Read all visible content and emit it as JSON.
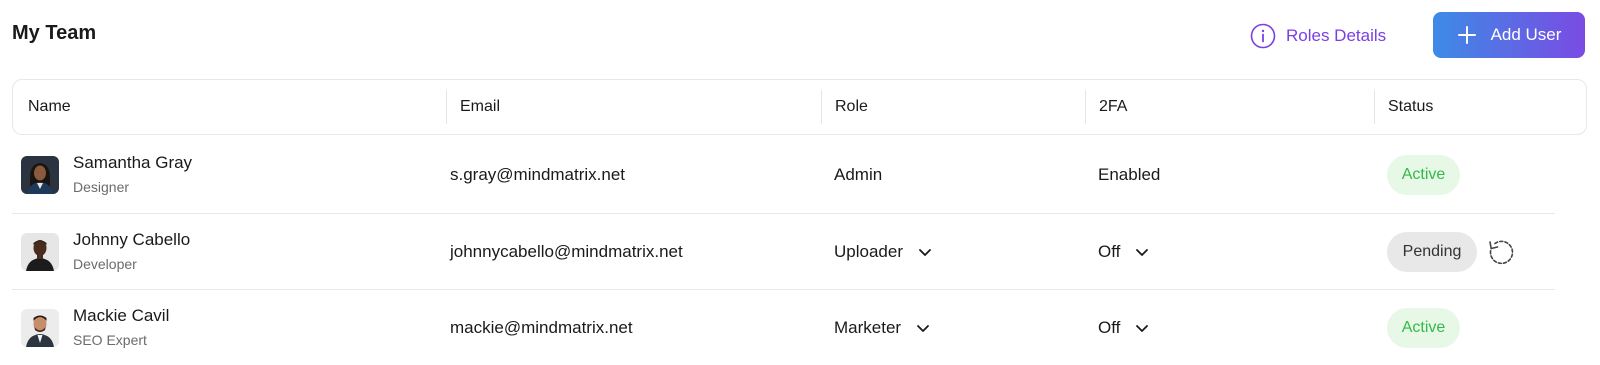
{
  "header": {
    "title": "My Team",
    "roles_details_label": "Roles Details",
    "add_user_label": "Add User"
  },
  "colors": {
    "accent_purple": "#7b3fe4",
    "gradient_start": "#3d8be6",
    "gradient_end": "#7a4be3",
    "active_bg": "#e8f8e6",
    "active_text": "#35b94a",
    "pending_bg": "#e8e8e8"
  },
  "table": {
    "columns": [
      "Name",
      "Email",
      "Role",
      "2FA",
      "Status"
    ],
    "rows": [
      {
        "name": "Samantha Gray",
        "job_title": "Designer",
        "email": "s.gray@mindmatrix.net",
        "role": "Admin",
        "role_editable": false,
        "twofa": "Enabled",
        "twofa_editable": false,
        "status": "Active",
        "avatar_icon": "avatar-woman"
      },
      {
        "name": "Johnny Cabello",
        "job_title": "Developer",
        "email": "johnnycabello@mindmatrix.net",
        "role": "Uploader",
        "role_editable": true,
        "twofa": "Off",
        "twofa_editable": true,
        "status": "Pending",
        "avatar_icon": "avatar-man"
      },
      {
        "name": "Mackie Cavil",
        "job_title": "SEO Expert",
        "email": "mackie@mindmatrix.net",
        "role": "Marketer",
        "role_editable": true,
        "twofa": "Off",
        "twofa_editable": true,
        "status": "Active",
        "avatar_icon": "avatar-man-suit"
      }
    ]
  }
}
